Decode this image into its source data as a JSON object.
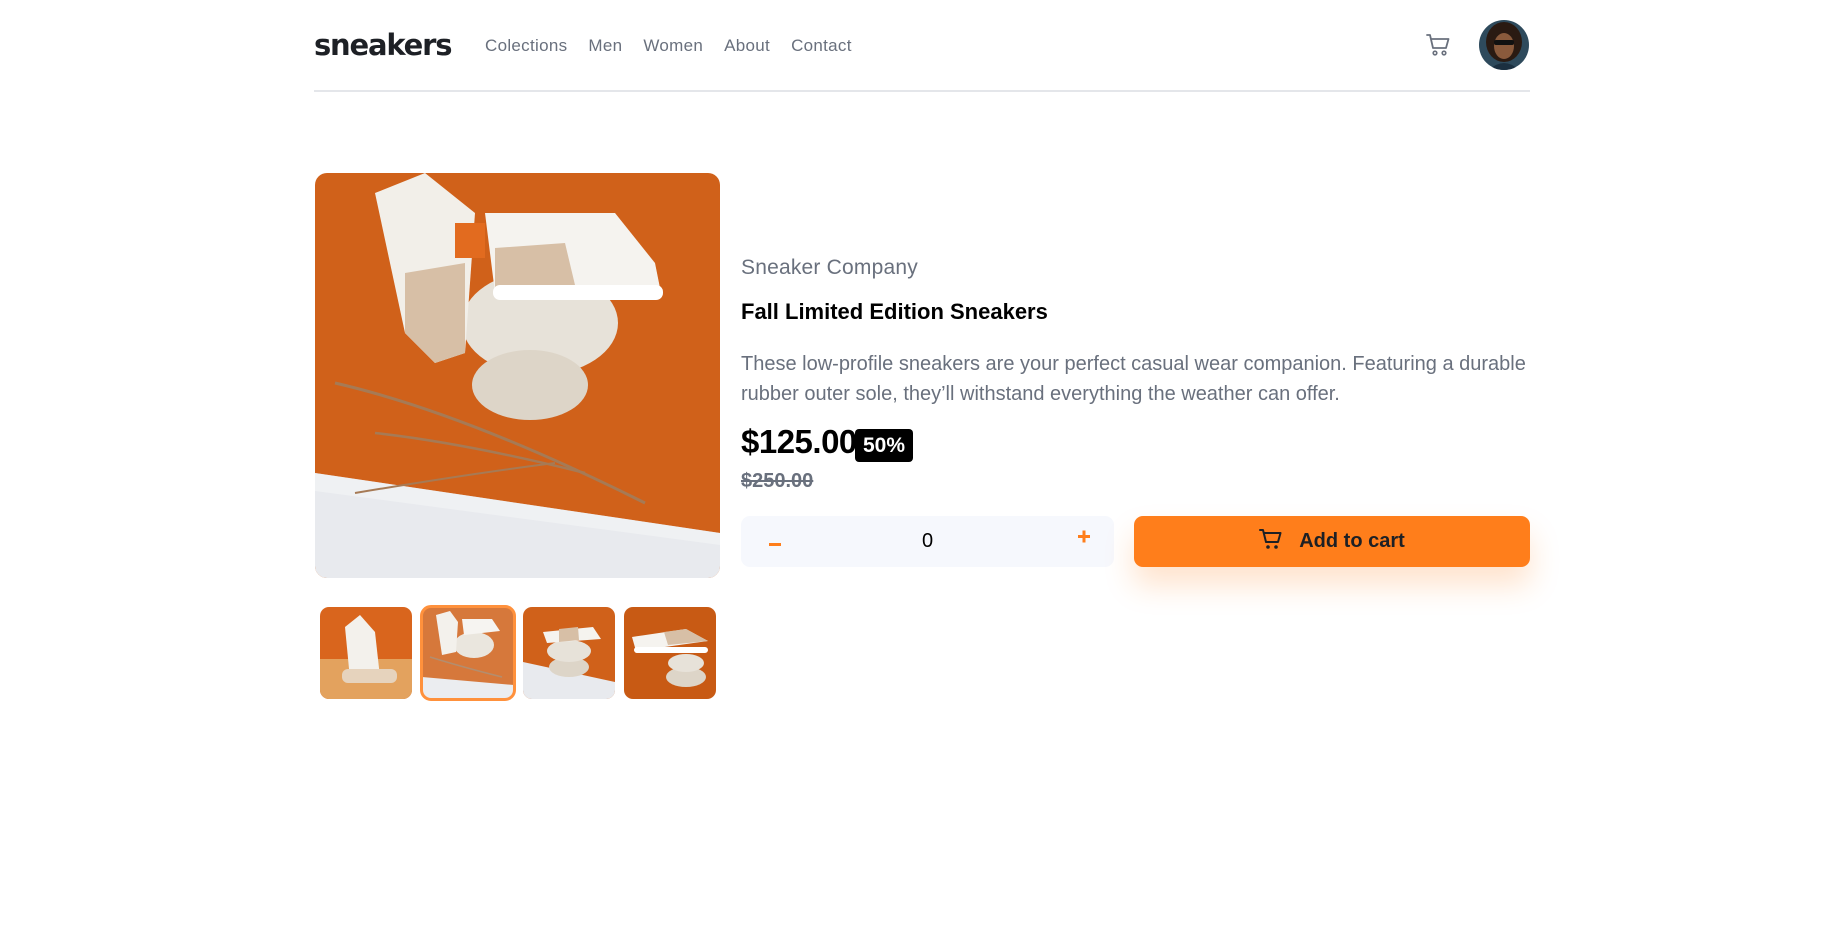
{
  "header": {
    "logo": "sneakers",
    "nav": [
      "Colections",
      "Men",
      "Women",
      "About",
      "Contact"
    ],
    "cart_icon": "cart-icon",
    "avatar_icon": "avatar"
  },
  "product": {
    "company": "Sneaker Company",
    "title": "Fall Limited Edition Sneakers",
    "description": "These low-profile sneakers are your perfect casual wear companion. Featuring a durable rubber outer sole, they’ll withstand everything the weather can offer.",
    "price": "$125.00",
    "discount": "50%",
    "original_price": "$250.00"
  },
  "cart_controls": {
    "quantity": "0",
    "minus_label": "–",
    "plus_label": "+",
    "add_to_cart_label": "Add to cart"
  },
  "gallery": {
    "active_thumbnail": 2,
    "thumbnail_count": 4
  },
  "colors": {
    "accent": "#ff7e1b",
    "text_dark": "#1d2025",
    "text_grey": "#69707d",
    "light_bg": "#f6f8fd"
  }
}
